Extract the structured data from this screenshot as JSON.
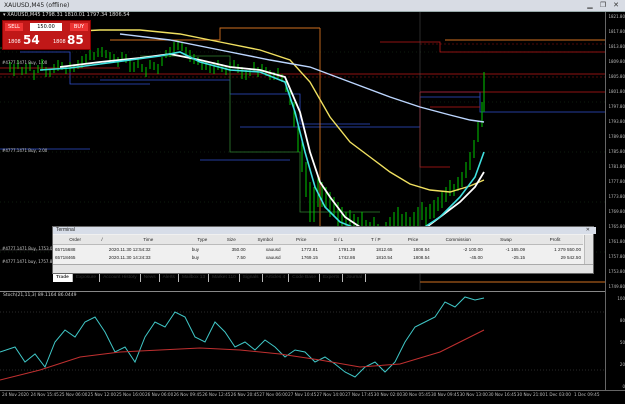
{
  "window": {
    "title": "XAUUSD,M45 (offline)",
    "minimize_glyph": "▁",
    "restore_glyph": "❐",
    "close_glyph": "✕"
  },
  "chart_header": {
    "symbol_info": "▾ XAUUSD,M45  1798.31 1810.01 1797.34 1806.54"
  },
  "one_click": {
    "sell_label": "SELL",
    "buy_label": "BUY",
    "lot_value": "150.00",
    "sell_small": "1808",
    "sell_big": "54",
    "buy_small": "1808",
    "buy_big": "85"
  },
  "price_axis": {
    "ticks": [
      "1821.80",
      "1817.80",
      "1813.80",
      "1809.80",
      "1805.80",
      "1801.80",
      "1797.80",
      "1793.80",
      "1789.80",
      "1785.80",
      "1781.80",
      "1777.80",
      "1773.80",
      "1769.80",
      "1765.80",
      "1761.80",
      "1757.80",
      "1753.80",
      "1749.80"
    ],
    "osc_ticks": [
      "100",
      "80",
      "50",
      "20",
      "0"
    ]
  },
  "oscillator": {
    "label": "Stoch(21,11,3) 89.1164 86.0449"
  },
  "time_axis": {
    "labels": [
      "24 Nov 2020",
      "24 Nov 15:45",
      "25 Nov 06:00",
      "25 Nov 12:00",
      "25 Nov 16:00",
      "26 Nov 06:00",
      "26 Nov 09:45",
      "26 Nov 12:45",
      "26 Nov 20:45",
      "27 Nov 06:00",
      "27 Nov 10:45",
      "27 Nov 14:00",
      "27 Nov 17:45",
      "30 Nov 02:00",
      "30 Nov 05:45",
      "30 Nov 09:45",
      "30 Nov 13:00",
      "30 Nov 16:45",
      "30 Nov 21:00",
      "1 Dec 03:00",
      "1 Dec 09:45"
    ]
  },
  "terminal": {
    "title": "Terminal",
    "close_glyph": "✕",
    "columns": [
      "Order",
      "/",
      "Time",
      "Type",
      "Size",
      "Symbol",
      "Price",
      "S / L",
      "T / P",
      "Price",
      "Commission",
      "Swap",
      "Profit"
    ],
    "rows": [
      {
        "order": "65715688",
        "time": "2020.11.30 12:54:32",
        "type": "buy",
        "size": "350.00",
        "symbol": "xauusd",
        "price": "1772.81",
        "sl": "1791.39",
        "tp": "1812.65",
        "cur": "1808.54",
        "commission": "-2 100.00",
        "swap": "-1 165.09",
        "profit": "1 279 550.00"
      },
      {
        "order": "65718465",
        "time": "2020.11.30 14:24:33",
        "type": "buy",
        "size": "7.50",
        "symbol": "xauusd",
        "price": "1769.15",
        "sl": "1742.86",
        "tp": "1810.54",
        "cur": "1808.54",
        "commission": "-45.00",
        "swap": "-25.15",
        "profit": "29 542.50"
      }
    ],
    "tabs": [
      {
        "label": "Trade",
        "active": true
      },
      {
        "label": "Exposure"
      },
      {
        "label": "Account History"
      },
      {
        "label": "News"
      },
      {
        "label": "Alerts"
      },
      {
        "label": "Mailbox",
        "badge": "13"
      },
      {
        "label": "Market",
        "badge": "110"
      },
      {
        "label": "Signals"
      },
      {
        "label": "Articles",
        "badge": "4"
      },
      {
        "label": "Code Base"
      },
      {
        "label": "Experts"
      },
      {
        "label": "Journal"
      }
    ]
  },
  "line_labels": {
    "a": "#4777.1471 Buy, 1.00",
    "b": "#4777.1471 Buy, 2.00",
    "c": "#4777.1471 Buy, 1753.00",
    "d": "#4777.1471 buy, 1757.80"
  },
  "colors": {
    "background": "#000000",
    "candle": "#00c800",
    "ma_white": "#ffffff",
    "ma_yellow": "#f0e060",
    "ma_blue": "#bcd6ff",
    "ma_cyan": "#40e0e0",
    "level_red": "#c01818",
    "level_orange": "#d07020",
    "level_blue": "#3050d0",
    "osc_main": "#40c8c8",
    "osc_signal": "#c03030"
  }
}
